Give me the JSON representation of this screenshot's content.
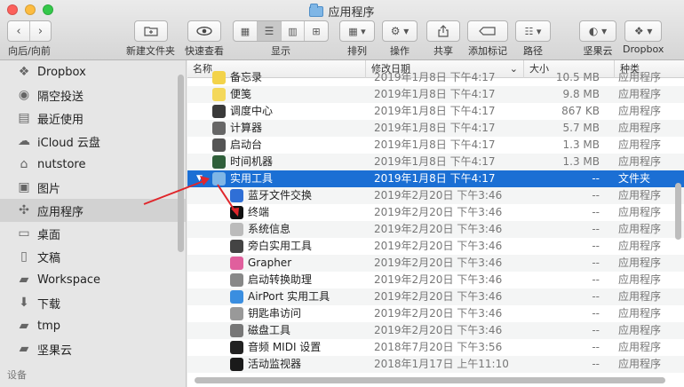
{
  "window": {
    "title": "应用程序"
  },
  "toolbar": {
    "nav_label": "向后/向前",
    "new_folder_label": "新建文件夹",
    "quicklook_label": "快速查看",
    "view_label": "显示",
    "arrange_label": "排列",
    "action_label": "操作",
    "share_label": "共享",
    "tags_label": "添加标记",
    "path_label": "路径",
    "nutstore_label": "坚果云",
    "dropbox_label": "Dropbox"
  },
  "sidebar": {
    "items": [
      {
        "label": "Dropbox",
        "icon": "dropbox-icon"
      },
      {
        "label": "隔空投送",
        "icon": "airdrop-icon"
      },
      {
        "label": "最近使用",
        "icon": "recents-icon"
      },
      {
        "label": "iCloud 云盘",
        "icon": "cloud-icon"
      },
      {
        "label": "nutstore",
        "icon": "home-icon"
      },
      {
        "label": "图片",
        "icon": "camera-icon"
      },
      {
        "label": "应用程序",
        "icon": "apps-icon"
      },
      {
        "label": "桌面",
        "icon": "desktop-icon"
      },
      {
        "label": "文稿",
        "icon": "document-icon"
      },
      {
        "label": "Workspace",
        "icon": "folder-icon"
      },
      {
        "label": "下载",
        "icon": "download-icon"
      },
      {
        "label": "tmp",
        "icon": "folder-icon"
      },
      {
        "label": "坚果云",
        "icon": "folder-icon"
      }
    ],
    "devices_header": "设备"
  },
  "columns": {
    "name": "名称",
    "date": "修改日期",
    "size": "大小",
    "kind": "种类"
  },
  "rows": [
    {
      "name": "备忘录",
      "date": "2019年1月8日 下午4:17",
      "size": "10.5 MB",
      "kind": "应用程序",
      "color": "#f3d34a",
      "indent": 0
    },
    {
      "name": "便笺",
      "date": "2019年1月8日 下午4:17",
      "size": "9.8 MB",
      "kind": "应用程序",
      "color": "#f4d85a",
      "indent": 0
    },
    {
      "name": "调度中心",
      "date": "2019年1月8日 下午4:17",
      "size": "867 KB",
      "kind": "应用程序",
      "color": "#3a3a3a",
      "indent": 0
    },
    {
      "name": "计算器",
      "date": "2019年1月8日 下午4:17",
      "size": "5.7 MB",
      "kind": "应用程序",
      "color": "#666666",
      "indent": 0
    },
    {
      "name": "启动台",
      "date": "2019年1月8日 下午4:17",
      "size": "1.3 MB",
      "kind": "应用程序",
      "color": "#555555",
      "indent": 0
    },
    {
      "name": "时间机器",
      "date": "2019年1月8日 下午4:17",
      "size": "1.3 MB",
      "kind": "应用程序",
      "color": "#2f5f3a",
      "indent": 0
    },
    {
      "name": "实用工具",
      "date": "2019年1月8日 下午4:17",
      "size": "--",
      "kind": "文件夹",
      "color": "#7fb6e6",
      "indent": 0,
      "selected": true
    },
    {
      "name": "蓝牙文件交换",
      "date": "2019年2月20日 下午3:46",
      "size": "--",
      "kind": "应用程序",
      "color": "#2f6fd6",
      "indent": 1
    },
    {
      "name": "终端",
      "date": "2019年2月20日 下午3:46",
      "size": "--",
      "kind": "应用程序",
      "color": "#111111",
      "indent": 1
    },
    {
      "name": "系统信息",
      "date": "2019年2月20日 下午3:46",
      "size": "--",
      "kind": "应用程序",
      "color": "#bbbbbb",
      "indent": 1
    },
    {
      "name": "旁白实用工具",
      "date": "2019年2月20日 下午3:46",
      "size": "--",
      "kind": "应用程序",
      "color": "#444444",
      "indent": 1
    },
    {
      "name": "Grapher",
      "date": "2019年2月20日 下午3:46",
      "size": "--",
      "kind": "应用程序",
      "color": "#e05f9d",
      "indent": 1
    },
    {
      "name": "启动转换助理",
      "date": "2019年2月20日 下午3:46",
      "size": "--",
      "kind": "应用程序",
      "color": "#888888",
      "indent": 1
    },
    {
      "name": "AirPort 实用工具",
      "date": "2019年2月20日 下午3:46",
      "size": "--",
      "kind": "应用程序",
      "color": "#3a8ee0",
      "indent": 1
    },
    {
      "name": "钥匙串访问",
      "date": "2019年2月20日 下午3:46",
      "size": "--",
      "kind": "应用程序",
      "color": "#999999",
      "indent": 1
    },
    {
      "name": "磁盘工具",
      "date": "2019年2月20日 下午3:46",
      "size": "--",
      "kind": "应用程序",
      "color": "#777777",
      "indent": 1
    },
    {
      "name": "音频 MIDI 设置",
      "date": "2018年7月20日 下午3:56",
      "size": "--",
      "kind": "应用程序",
      "color": "#222222",
      "indent": 1
    },
    {
      "name": "活动监视器",
      "date": "2018年1月17日 上午11:10",
      "size": "--",
      "kind": "应用程序",
      "color": "#1a1a1a",
      "indent": 1
    }
  ],
  "annotation_color": "#e0262b"
}
